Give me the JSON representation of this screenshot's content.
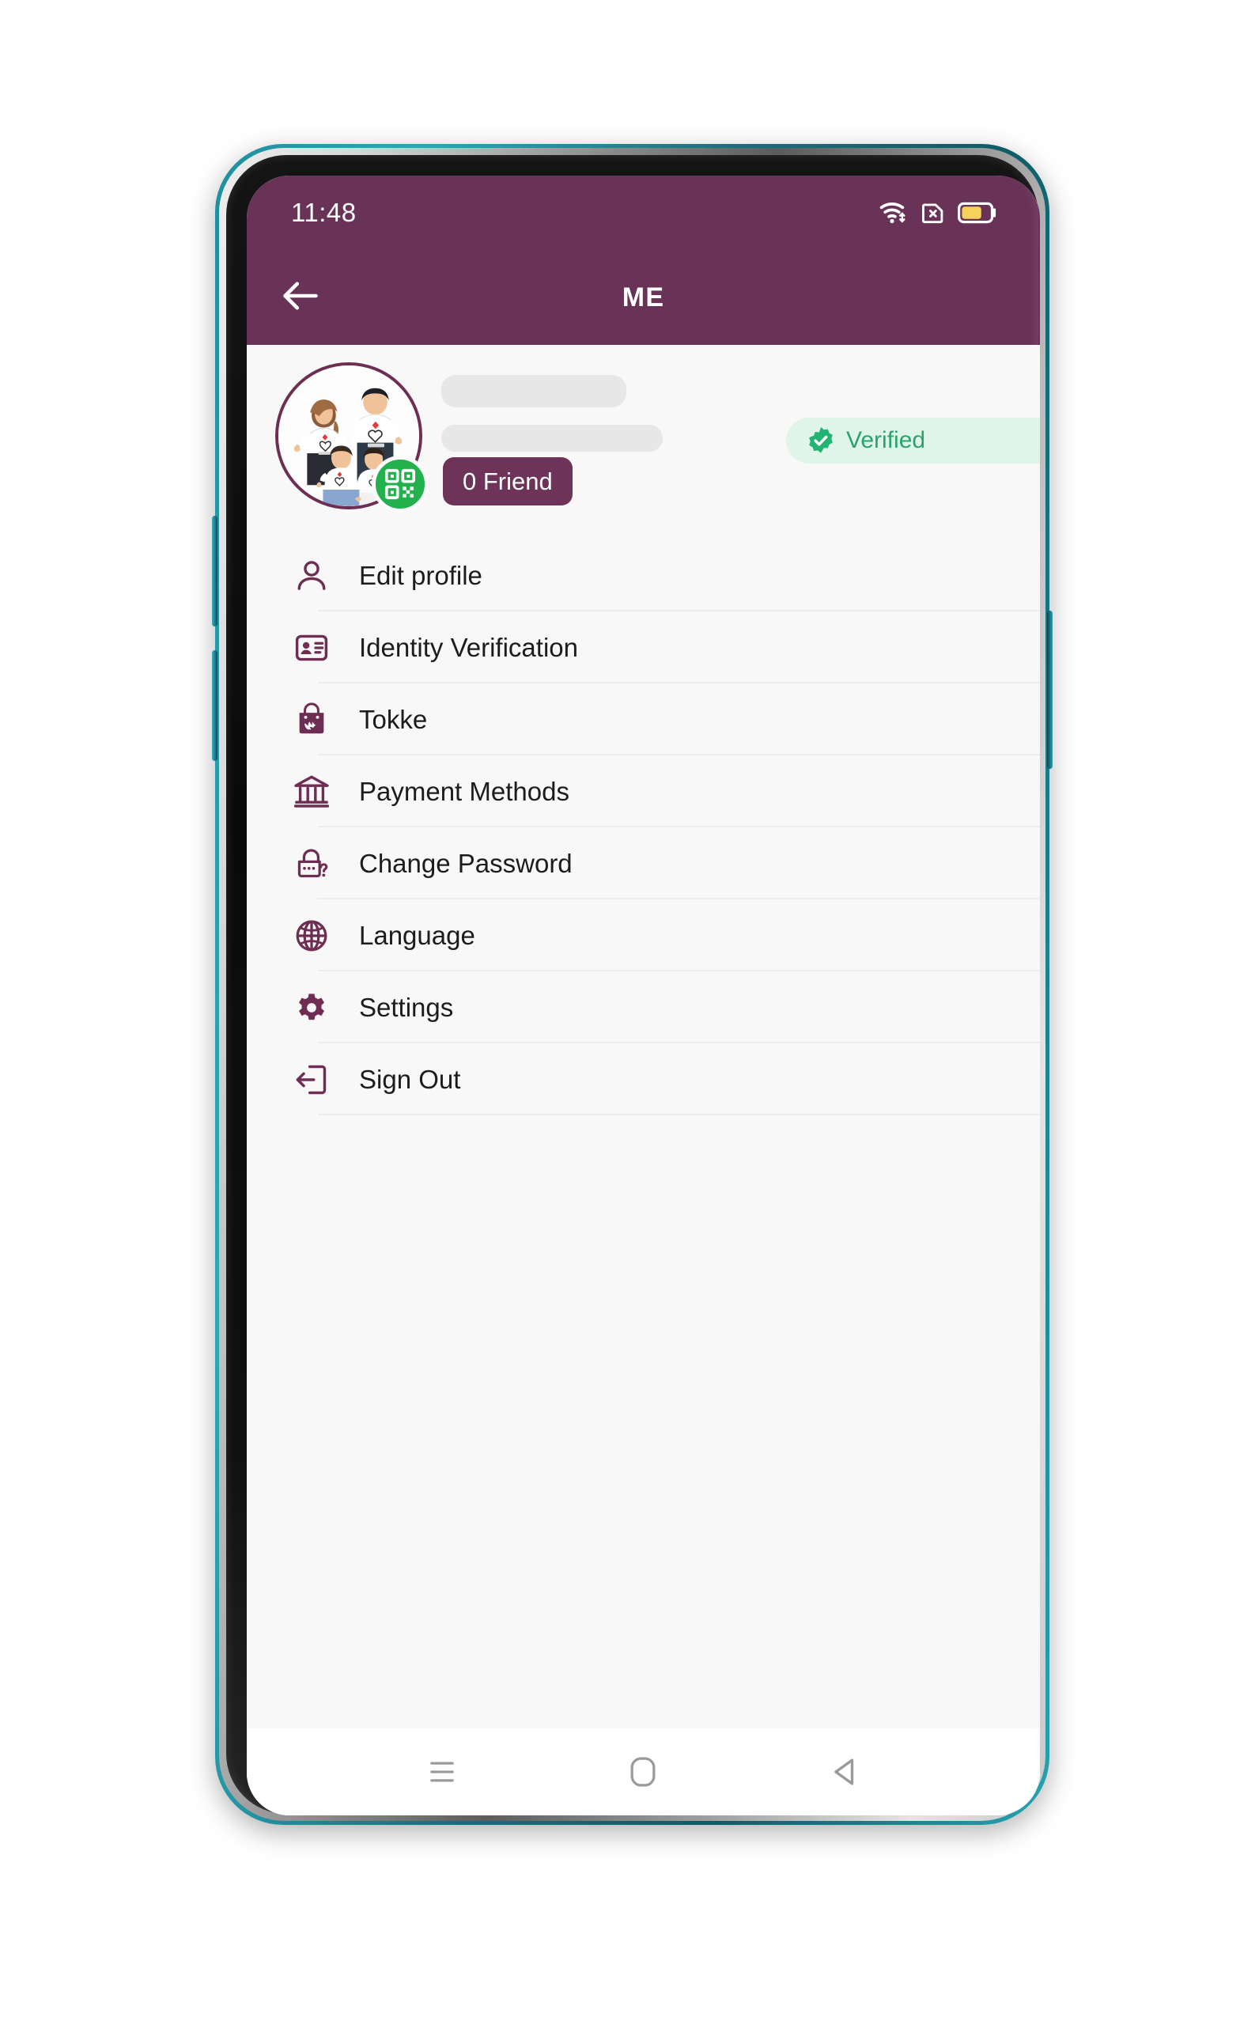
{
  "status_bar": {
    "time": "11:48",
    "icons": [
      "wifi-icon",
      "no-sim-icon",
      "battery-icon"
    ],
    "battery_level_pct": 60
  },
  "app_bar": {
    "title": "ME",
    "back_icon": "arrow-left-icon"
  },
  "profile": {
    "avatar_alt": "family-photo-avatar",
    "qr_icon": "qr-code-icon",
    "name_placeholder": "",
    "email_placeholder": "",
    "verified": {
      "label": "Verified",
      "icon": "verified-badge-icon"
    },
    "friend_button": {
      "label": "0 Friend",
      "count": 0
    }
  },
  "menu": {
    "items": [
      {
        "label": "Edit profile",
        "icon": "user-icon"
      },
      {
        "label": "Identity Verification",
        "icon": "id-card-icon"
      },
      {
        "label": "Tokke",
        "icon": "shopping-bag-icon"
      },
      {
        "label": "Payment Methods",
        "icon": "bank-icon"
      },
      {
        "label": "Change Password",
        "icon": "lock-question-icon"
      },
      {
        "label": "Language",
        "icon": "globe-icon"
      },
      {
        "label": "Settings",
        "icon": "gear-icon"
      },
      {
        "label": "Sign Out",
        "icon": "sign-out-icon"
      }
    ]
  },
  "nav_bar": {
    "buttons": [
      {
        "name": "recents-button",
        "icon": "hamburger-icon"
      },
      {
        "name": "home-button",
        "icon": "rounded-square-icon"
      },
      {
        "name": "back-button",
        "icon": "triangle-left-icon"
      }
    ]
  },
  "colors": {
    "brand_purple": "#693358",
    "icon_purple": "#6E2D53",
    "verified_green": "#2BA36A",
    "verified_bg": "#DFF5EA",
    "qr_green": "#22B14C",
    "content_bg": "#F8F8F8",
    "divider": "#EDEDED",
    "skeleton": "#E7E7E7",
    "battery_yellow": "#F6D25B",
    "phone_edge_teal": "#1b8c9c"
  }
}
